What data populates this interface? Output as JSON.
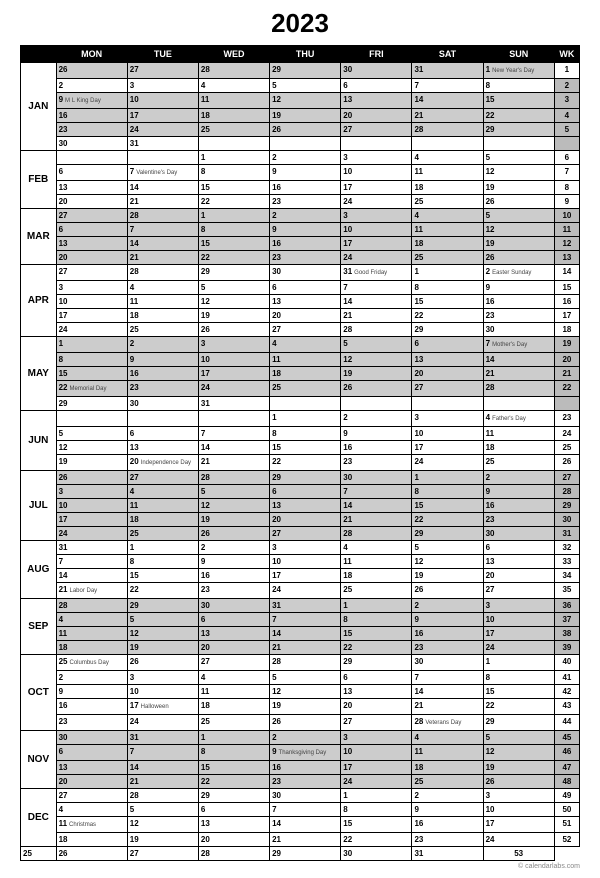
{
  "title": "2023",
  "footer": "© calendarlabs.com",
  "headers": [
    "MON",
    "TUE",
    "WED",
    "THU",
    "FRI",
    "SAT",
    "SUN",
    "WK"
  ],
  "months": [
    {
      "label": "JAN",
      "rows": 6
    },
    {
      "label": "FEB",
      "rows": 4
    },
    {
      "label": "MAR",
      "rows": 4
    },
    {
      "label": "APR",
      "rows": 5
    },
    {
      "label": "MAY",
      "rows": 5
    },
    {
      "label": "JUN",
      "rows": 4
    },
    {
      "label": "JUL",
      "rows": 5
    },
    {
      "label": "AUG",
      "rows": 4
    },
    {
      "label": "SEP",
      "rows": 4
    },
    {
      "label": "OCT",
      "rows": 5
    },
    {
      "label": "NOV",
      "rows": 4
    },
    {
      "label": "DEC",
      "rows": 4
    }
  ],
  "events": {
    "0,6": "New Year's Day",
    "2,0": "M L King Day",
    "7,1": "Valentine's Day",
    "14,4": "Good Friday",
    "14,6": "Easter Sunday",
    "19,6": "Mother's Day",
    "22,0": "Memorial Day",
    "24,6": "Father's Day",
    "27,1": "Independence Day",
    "36,0": "Labor Day",
    "41,0": "Columbus Day",
    "44,1": "Halloween",
    "45,5": "Veterans Day",
    "47,3": "Thanksgiving Day",
    "52,0": "Christmas"
  },
  "rows": [
    {
      "g": 1,
      "d": [
        26,
        27,
        28,
        29,
        30,
        31,
        1
      ],
      "wk": 1,
      "wkw": 1
    },
    {
      "g": 0,
      "d": [
        2,
        3,
        4,
        5,
        6,
        7,
        8
      ],
      "wk": 2
    },
    {
      "g": 1,
      "d": [
        9,
        10,
        11,
        12,
        13,
        14,
        15
      ],
      "wk": 3
    },
    {
      "g": 1,
      "d": [
        16,
        17,
        18,
        19,
        20,
        21,
        22
      ],
      "wk": 4
    },
    {
      "g": 1,
      "d": [
        23,
        24,
        25,
        26,
        27,
        28,
        29
      ],
      "wk": 5
    },
    {
      "g": 0,
      "d": [
        30,
        31,
        "",
        "",
        "",
        "",
        ""
      ],
      "wk": ""
    },
    {
      "g": 0,
      "d": [
        "",
        "",
        1,
        2,
        3,
        4,
        5
      ],
      "wk": 6,
      "wkw": 1
    },
    {
      "g": 0,
      "d": [
        6,
        7,
        8,
        9,
        10,
        11,
        12
      ],
      "wk": 7,
      "wkw": 1
    },
    {
      "g": 0,
      "d": [
        13,
        14,
        15,
        16,
        17,
        18,
        19
      ],
      "wk": 8,
      "wkw": 1
    },
    {
      "g": 0,
      "d": [
        20,
        21,
        22,
        23,
        24,
        25,
        26
      ],
      "wk": 9,
      "wkw": 1
    },
    {
      "g": 1,
      "d": [
        27,
        28,
        1,
        2,
        3,
        4,
        5
      ],
      "wk": 10
    },
    {
      "g": 1,
      "d": [
        6,
        7,
        8,
        9,
        10,
        11,
        12
      ],
      "wk": 11
    },
    {
      "g": 1,
      "d": [
        13,
        14,
        15,
        16,
        17,
        18,
        19
      ],
      "wk": 12
    },
    {
      "g": 1,
      "d": [
        20,
        21,
        22,
        23,
        24,
        25,
        26
      ],
      "wk": 13
    },
    {
      "g": 0,
      "d": [
        27,
        28,
        29,
        30,
        31,
        1,
        2
      ],
      "wk": 14,
      "wkw": 1
    },
    {
      "g": 0,
      "d": [
        3,
        4,
        5,
        6,
        7,
        8,
        9
      ],
      "wk": 15,
      "wkw": 1
    },
    {
      "g": 0,
      "d": [
        10,
        11,
        12,
        13,
        14,
        15,
        16
      ],
      "wk": 16,
      "wkw": 1
    },
    {
      "g": 0,
      "d": [
        17,
        18,
        19,
        20,
        21,
        22,
        23
      ],
      "wk": 17,
      "wkw": 1
    },
    {
      "g": 0,
      "d": [
        24,
        25,
        26,
        27,
        28,
        29,
        30
      ],
      "wk": 18,
      "wkw": 1
    },
    {
      "g": 1,
      "d": [
        1,
        2,
        3,
        4,
        5,
        6,
        7
      ],
      "wk": 19
    },
    {
      "g": 1,
      "d": [
        8,
        9,
        10,
        11,
        12,
        13,
        14
      ],
      "wk": 20
    },
    {
      "g": 1,
      "d": [
        15,
        16,
        17,
        18,
        19,
        20,
        21
      ],
      "wk": 21
    },
    {
      "g": 1,
      "d": [
        22,
        23,
        24,
        25,
        26,
        27,
        28
      ],
      "wk": 22
    },
    {
      "g": 0,
      "d": [
        29,
        30,
        31,
        "",
        "",
        "",
        ""
      ],
      "wk": ""
    },
    {
      "g": 0,
      "d": [
        "",
        "",
        "",
        1,
        2,
        3,
        4
      ],
      "wk": 23,
      "wkw": 1
    },
    {
      "g": 0,
      "d": [
        5,
        6,
        7,
        8,
        9,
        10,
        11
      ],
      "wk": 24,
      "wkw": 1
    },
    {
      "g": 0,
      "d": [
        12,
        13,
        14,
        15,
        16,
        17,
        18
      ],
      "wk": 25,
      "wkw": 1
    },
    {
      "g": 0,
      "d": [
        19,
        20,
        21,
        22,
        23,
        24,
        25
      ],
      "wk": 26,
      "wkw": 1
    },
    {
      "g": 1,
      "d": [
        26,
        27,
        28,
        29,
        30,
        1,
        2
      ],
      "wk": 27
    },
    {
      "g": 1,
      "d": [
        3,
        4,
        5,
        6,
        7,
        8,
        9
      ],
      "wk": 28
    },
    {
      "g": 1,
      "d": [
        10,
        11,
        12,
        13,
        14,
        15,
        16
      ],
      "wk": 29
    },
    {
      "g": 1,
      "d": [
        17,
        18,
        19,
        20,
        21,
        22,
        23
      ],
      "wk": 30
    },
    {
      "g": 1,
      "d": [
        24,
        25,
        26,
        27,
        28,
        29,
        30
      ],
      "wk": 31
    },
    {
      "g": 0,
      "d": [
        31,
        1,
        2,
        3,
        4,
        5,
        6
      ],
      "wk": 32,
      "wkw": 1
    },
    {
      "g": 0,
      "d": [
        7,
        8,
        9,
        10,
        11,
        12,
        13
      ],
      "wk": 33,
      "wkw": 1
    },
    {
      "g": 0,
      "d": [
        14,
        15,
        16,
        17,
        18,
        19,
        20
      ],
      "wk": 34,
      "wkw": 1
    },
    {
      "g": 0,
      "d": [
        21,
        22,
        23,
        24,
        25,
        26,
        27
      ],
      "wk": 35,
      "wkw": 1
    },
    {
      "g": 1,
      "d": [
        28,
        29,
        30,
        31,
        1,
        2,
        3
      ],
      "wk": 36
    },
    {
      "g": 1,
      "d": [
        4,
        5,
        6,
        7,
        8,
        9,
        10
      ],
      "wk": 37
    },
    {
      "g": 1,
      "d": [
        11,
        12,
        13,
        14,
        15,
        16,
        17
      ],
      "wk": 38
    },
    {
      "g": 1,
      "d": [
        18,
        19,
        20,
        21,
        22,
        23,
        24
      ],
      "wk": 39
    },
    {
      "g": 0,
      "d": [
        25,
        26,
        27,
        28,
        29,
        30,
        1
      ],
      "wk": 40,
      "wkw": 1
    },
    {
      "g": 0,
      "d": [
        2,
        3,
        4,
        5,
        6,
        7,
        8
      ],
      "wk": 41,
      "wkw": 1
    },
    {
      "g": 0,
      "d": [
        9,
        10,
        11,
        12,
        13,
        14,
        15
      ],
      "wk": 42,
      "wkw": 1
    },
    {
      "g": 0,
      "d": [
        16,
        17,
        18,
        19,
        20,
        21,
        22
      ],
      "wk": 43,
      "wkw": 1
    },
    {
      "g": 0,
      "d": [
        23,
        24,
        25,
        26,
        27,
        28,
        29
      ],
      "wk": 44,
      "wkw": 1
    },
    {
      "g": 1,
      "d": [
        30,
        31,
        1,
        2,
        3,
        4,
        5
      ],
      "wk": 45
    },
    {
      "g": 1,
      "d": [
        6,
        7,
        8,
        9,
        10,
        11,
        12
      ],
      "wk": 46
    },
    {
      "g": 1,
      "d": [
        13,
        14,
        15,
        16,
        17,
        18,
        19
      ],
      "wk": 47
    },
    {
      "g": 1,
      "d": [
        20,
        21,
        22,
        23,
        24,
        25,
        26
      ],
      "wk": 48
    },
    {
      "g": 0,
      "d": [
        27,
        28,
        29,
        30,
        1,
        2,
        3
      ],
      "wk": 49,
      "wkw": 1
    },
    {
      "g": 0,
      "d": [
        4,
        5,
        6,
        7,
        8,
        9,
        10
      ],
      "wk": 50,
      "wkw": 1
    },
    {
      "g": 0,
      "d": [
        11,
        12,
        13,
        14,
        15,
        16,
        17
      ],
      "wk": 51,
      "wkw": 1
    },
    {
      "g": 0,
      "d": [
        18,
        19,
        20,
        21,
        22,
        23,
        24
      ],
      "wk": 52,
      "wkw": 1
    },
    {
      "g": 0,
      "d": [
        25,
        26,
        27,
        28,
        29,
        30,
        31
      ],
      "wk": 53,
      "wkw": 1
    }
  ]
}
